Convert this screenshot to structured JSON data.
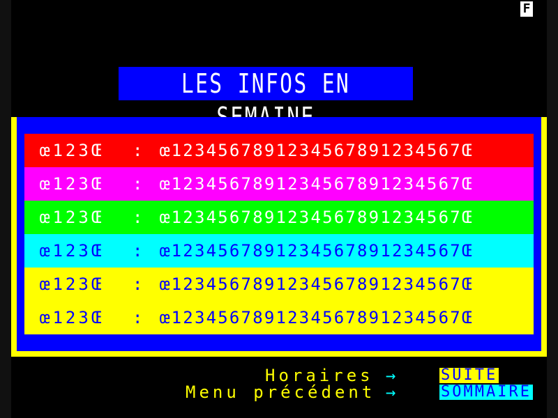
{
  "page": {
    "indicator": "F",
    "title": "LES INFOS EN SEMAINE"
  },
  "rows": [
    {
      "code": "œ123Œ",
      "separator": ":",
      "value": "œ1234567891234567891234567Œ",
      "color": "#ff0000"
    },
    {
      "code": "œ123Œ",
      "separator": ":",
      "value": "œ1234567891234567891234567Œ",
      "color": "#ff00ff"
    },
    {
      "code": "œ123Œ",
      "separator": ":",
      "value": "œ1234567891234567891234567Œ",
      "color": "#00ff00"
    },
    {
      "code": "œ123Œ",
      "separator": ":",
      "value": "œ1234567891234567891234567Œ",
      "color": "#00ffff"
    },
    {
      "code": "œ123Œ",
      "separator": ":",
      "value": "œ1234567891234567891234567Œ",
      "color": "#ffff00"
    },
    {
      "code": "œ123Œ",
      "separator": ":",
      "value": "œ1234567891234567891234567Œ",
      "color": "#ffff00"
    }
  ],
  "navigation": {
    "horaires_label": "Horaires",
    "menu_label": "Menu précédent",
    "arrow": "→",
    "suite_key": "SUITE",
    "sommaire_key": "SOMMAIRE"
  },
  "colors": {
    "background": "#000000",
    "title_bg": "#0000ff",
    "frame_outer": "#ffff00",
    "frame_inner": "#0000ff"
  }
}
